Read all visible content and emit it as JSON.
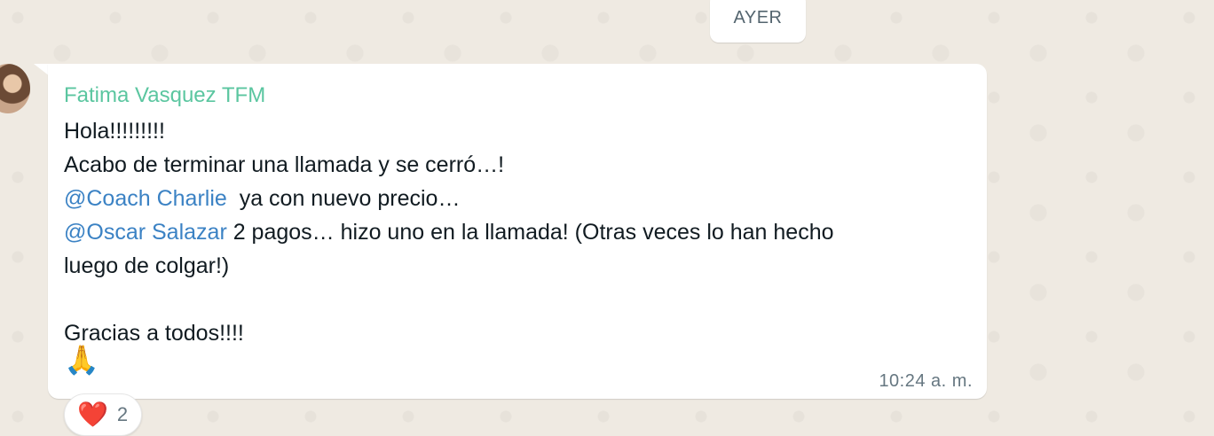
{
  "date_chip": "AYER",
  "message": {
    "sender": "Fatima Vasquez TFM",
    "line1": "Hola!!!!!!!!!",
    "line2": "Acabo de terminar una llamada y se cerró…!",
    "line3_mention": "@Coach Charlie",
    "line3_text": "  ya con nuevo precio…",
    "line4_mention": "@Oscar Salazar",
    "line4_text": " 2 pagos… hizo uno en la llamada! (Otras veces lo han hecho",
    "line5": "luego de colgar!)",
    "line6": "Gracias a todos!!!!",
    "emoji": "🙏",
    "time": "10:24 a. m."
  },
  "reaction": {
    "icon": "heart-icon",
    "emoji": "❤️",
    "count": "2"
  },
  "colors": {
    "background": "#efeae2",
    "sender": "#5bc6a0",
    "mention": "#3b82c4",
    "timestamp": "#667781"
  }
}
